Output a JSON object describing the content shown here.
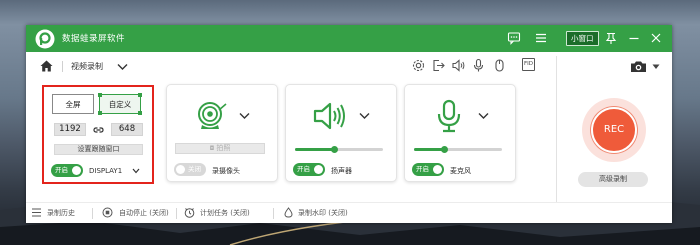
{
  "app": {
    "title": "数据蛙录屏软件",
    "mini_window_label": "小窗口"
  },
  "toolbar": {
    "breadcrumb": "视频录制"
  },
  "region": {
    "full_label": "全屏",
    "custom_label": "自定义",
    "width": "1192",
    "height": "648",
    "follow_window_label": "设置跟随窗口",
    "toggle_label": "开启",
    "display_label": "DISPLAY1"
  },
  "webcam": {
    "photo_label": "拍照",
    "toggle_label": "关闭",
    "name": "录摄像头"
  },
  "speaker": {
    "toggle_label": "开启",
    "name": "扬声器",
    "volume": 0.45
  },
  "mic": {
    "toggle_label": "开启",
    "name": "麦克风",
    "volume": 0.35
  },
  "record": {
    "rec_label": "REC",
    "advanced_label": "高级录制"
  },
  "footer": {
    "history": "录制历史",
    "auto_stop": "自动停止 (关闭)",
    "schedule": "计划任务 (关闭)",
    "watermark": "录制水印 (关闭)"
  },
  "colors": {
    "accent": "#35a046",
    "rec": "#ef5b3a",
    "highlight": "#e3241c"
  }
}
